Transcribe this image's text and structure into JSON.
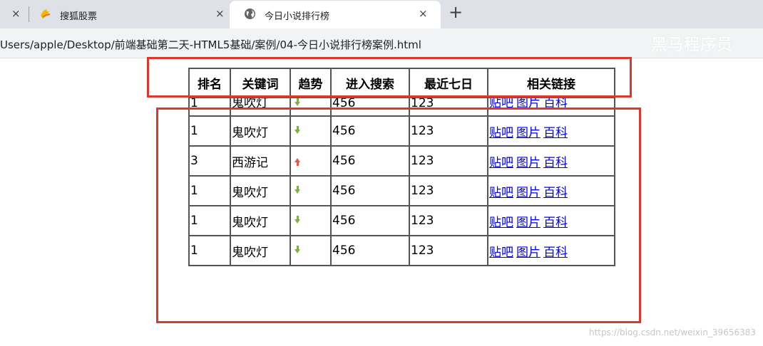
{
  "browser": {
    "tabs": [
      {
        "title": "搜狐股票",
        "icon": "sohu-icon",
        "active": false
      },
      {
        "title": "今日小说排行榜",
        "icon": "globe-icon",
        "active": true
      }
    ],
    "close_glyph": "×",
    "new_tab_glyph": "+",
    "url": "Users/apple/Desktop/前端基础第二天-HTML5基础/案例/04-今日小说排行榜案例.html",
    "watermark": "黑马程序员"
  },
  "table": {
    "headers": [
      "排名",
      "关键词",
      "趋势",
      "进入搜索",
      "最近七日",
      "相关链接"
    ],
    "rows": [
      {
        "rank": "1",
        "keyword": "鬼吹灯",
        "trend": "down",
        "search": "456",
        "week": "123"
      },
      {
        "rank": "1",
        "keyword": "鬼吹灯",
        "trend": "down",
        "search": "456",
        "week": "123"
      },
      {
        "rank": "3",
        "keyword": "西游记",
        "trend": "up",
        "search": "456",
        "week": "123"
      },
      {
        "rank": "1",
        "keyword": "鬼吹灯",
        "trend": "down",
        "search": "456",
        "week": "123"
      },
      {
        "rank": "1",
        "keyword": "鬼吹灯",
        "trend": "down",
        "search": "456",
        "week": "123"
      },
      {
        "rank": "1",
        "keyword": "鬼吹灯",
        "trend": "down",
        "search": "456",
        "week": "123"
      }
    ],
    "links": [
      "贴吧",
      "图片",
      "百科"
    ]
  },
  "colors": {
    "highlight_box": "#d93a2b",
    "link": "#0000ee",
    "trend_down": "#7fb045",
    "trend_up": "#e05a4a"
  },
  "page_watermark": "https://blog.csdn.net/weixin_39656383"
}
